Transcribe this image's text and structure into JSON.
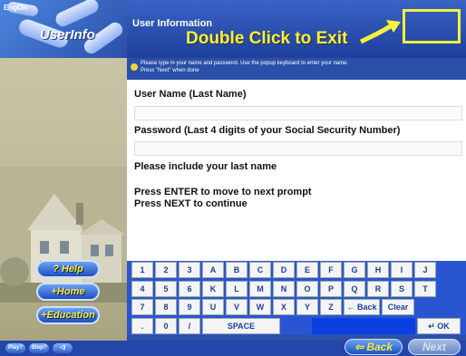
{
  "logo": {
    "small_text": "EngOn",
    "title": "UserInfo"
  },
  "header": {
    "title": "User Information",
    "hint": "Double Click to Exit"
  },
  "instructions": {
    "line1": "Please type in your name and password. Use the popup keyboard to enter your name.",
    "line2": "Press \"Next\" when done"
  },
  "fields": [
    {
      "label": "User Name (Last Name)",
      "value": "",
      "placeholder": ""
    },
    {
      "label": "Password (Last 4 digits of your Social Security Number)",
      "value": "",
      "placeholder": ""
    }
  ],
  "messages": {
    "error": "Please include your last name",
    "line1": "Press ENTER to move to next prompt",
    "line2": "Press NEXT to continue"
  },
  "sidebar": {
    "help": "? Help",
    "home": "+Home",
    "education": "+Education"
  },
  "keyboard": {
    "rows": [
      [
        "1",
        "2",
        "3",
        "A",
        "B",
        "C",
        "D",
        "E",
        "F",
        "G",
        "H",
        "I",
        "J"
      ],
      [
        "4",
        "5",
        "6",
        "K",
        "L",
        "M",
        "N",
        "O",
        "P",
        "Q",
        "R",
        "S",
        "T"
      ],
      [
        "7",
        "8",
        "9",
        "U",
        "V",
        "W",
        "X",
        "Y",
        "Z",
        "← Back",
        "Clear"
      ],
      [
        ".",
        "0",
        "/",
        "SPACE",
        "↵ OK"
      ]
    ]
  },
  "bottom": {
    "btn1": "Play?",
    "btn2": "Stop?",
    "btn3": "◁)",
    "back": "⇦ Back",
    "next": "Next"
  },
  "colors": {
    "accent_yellow": "#f6f23a",
    "header_blue": "#2a4fa8",
    "keyboard_blue": "#2a55d0"
  }
}
